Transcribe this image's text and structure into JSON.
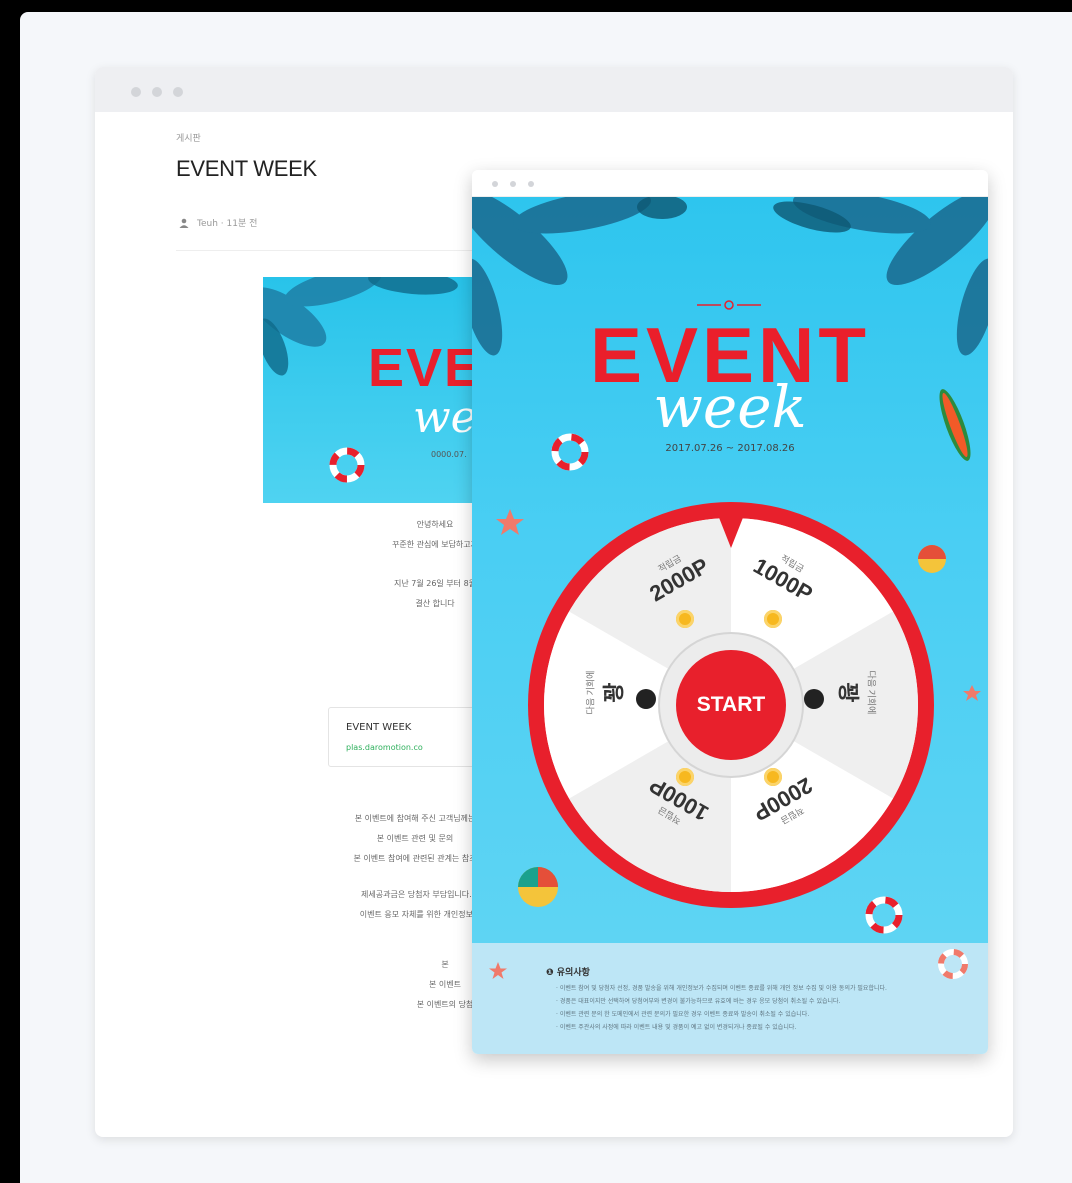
{
  "back_page": {
    "breadcrumb": "게시판",
    "title": "EVENT WEEK",
    "meta": "Teuh · 11분 전",
    "banner_event": "EVE",
    "banner_week": "we",
    "banner_date": "0000.07.",
    "paragraphs": [
      [
        "안녕하세요",
        "꾸준한 관심에 보답하고자"
      ],
      [
        "지난 7월 26일 부터 8월",
        "결산 합니다"
      ],
      [
        "본 이벤트에 참여해 주신 고객님께는",
        "본 이벤트 관련 및 문의",
        "본 이벤트 참여에 관련된 관계는 참조"
      ],
      [
        "제세공과금은 당첨자 부담입니다. 제세",
        "이벤트 응모 자체를 위한 개인정보 제공"
      ],
      [
        "본",
        "본 이벤트",
        "본 이벤트의 당첨"
      ]
    ],
    "link_card": {
      "title": "EVENT WEEK",
      "url": "plas.daromotion.co"
    }
  },
  "front_page": {
    "event_title": "EVENT",
    "week_title": "week",
    "date_range": "2017.07.26 ~ 2017.08.26",
    "start_label": "START",
    "wheel_segments": [
      {
        "small": "적립금",
        "big": "1000P"
      },
      {
        "small": "다음 기회에",
        "big": "꽝"
      },
      {
        "small": "적립금",
        "big": "2000P"
      },
      {
        "small": "적립금",
        "big": "1000P"
      },
      {
        "small": "다음 기회에",
        "big": "꽝"
      },
      {
        "small": "적립금",
        "big": "2000P"
      }
    ],
    "notice_title": "❶ 유의사항",
    "notice_lines": [
      "· 이벤트 참여 및 당첨자 선정, 경품 발송을 위해 개인정보가 수집되며 이벤트 종료를 위해 개인 정보 수집 및 이용 동의가 필요합니다.",
      "· 경품은 대표이지만 선택하여 당첨여부와 변경이 불가능하므로 유효에 바는 경우 응모 당첨이 취소될 수 있습니다.",
      "· 이벤트 관련 문의 한 도메인에서 관련 문의가 필요한 경우 이벤트 종료와 발송이 취소될 수 있습니다.",
      "· 이벤트 주관사의 사정에 따라 이벤트 내용 및 경품이 예고 없이 변경되거나 종료될 수 있습니다."
    ]
  },
  "colors": {
    "event_red": "#ea1f2b",
    "sky_blue": "#2ec5ee",
    "coin_gold": "#f7b81f"
  }
}
